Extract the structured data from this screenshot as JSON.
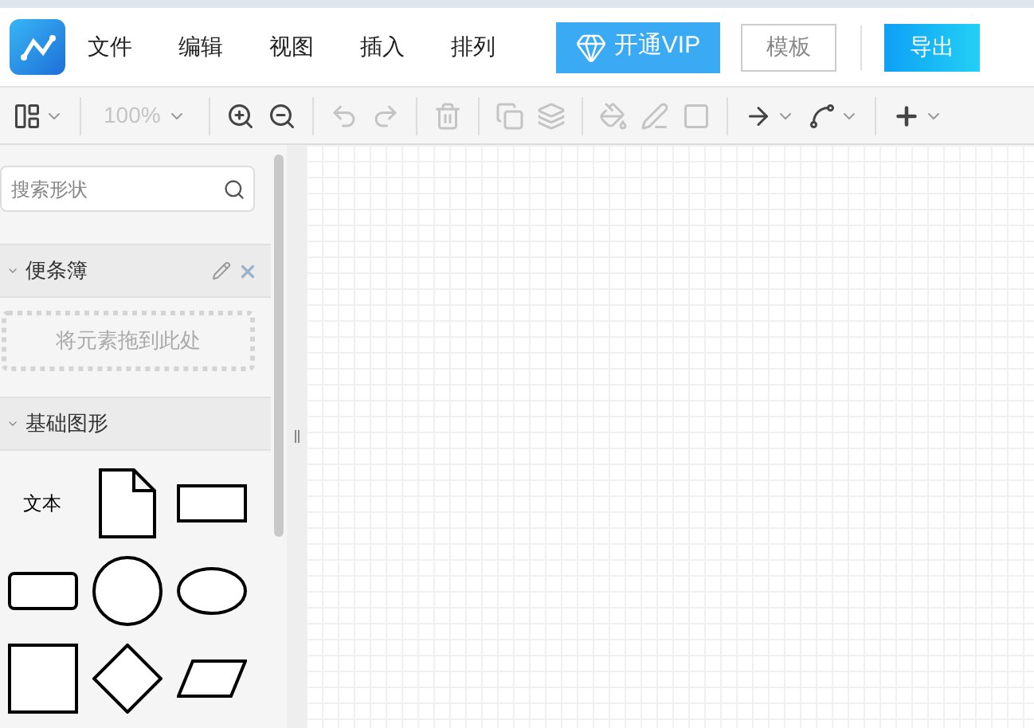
{
  "menu": [
    {
      "label": "文件"
    },
    {
      "label": "编辑"
    },
    {
      "label": "视图"
    },
    {
      "label": "插入"
    },
    {
      "label": "排列"
    }
  ],
  "vip_button": "开通VIP",
  "template_button": "模板",
  "export_button": "导出",
  "toolbar": [
    {
      "kind": "layout",
      "disabled": false,
      "dropdown": true
    },
    {
      "kind": "sep"
    },
    {
      "kind": "zoom",
      "label": "100%",
      "disabled": true,
      "dropdown": true
    },
    {
      "kind": "sep"
    },
    {
      "kind": "zoom-in",
      "disabled": false
    },
    {
      "kind": "zoom-out",
      "disabled": false
    },
    {
      "kind": "sep"
    },
    {
      "kind": "undo",
      "disabled": true
    },
    {
      "kind": "redo",
      "disabled": true
    },
    {
      "kind": "sep"
    },
    {
      "kind": "delete",
      "disabled": true
    },
    {
      "kind": "sep"
    },
    {
      "kind": "front",
      "disabled": true
    },
    {
      "kind": "back",
      "disabled": true
    },
    {
      "kind": "sep"
    },
    {
      "kind": "fill",
      "disabled": true
    },
    {
      "kind": "line",
      "disabled": true
    },
    {
      "kind": "shadow",
      "disabled": true
    },
    {
      "kind": "sep"
    },
    {
      "kind": "arrow",
      "disabled": false,
      "dropdown": true
    },
    {
      "kind": "connector",
      "disabled": false,
      "dropdown": true
    },
    {
      "kind": "sep"
    },
    {
      "kind": "plus",
      "disabled": false,
      "dropdown": true
    }
  ],
  "search": {
    "placeholder": "搜索形状"
  },
  "scratchpad": {
    "title": "便条簿",
    "expanded": true,
    "drop_hint": "将元素拖到此处"
  },
  "basic_shapes": {
    "title": "基础图形",
    "expanded": true,
    "shapes": [
      {
        "kind": "text",
        "label": "文本"
      },
      {
        "kind": "document"
      },
      {
        "kind": "rectangle"
      },
      {
        "kind": "rounded-rectangle"
      },
      {
        "kind": "circle"
      },
      {
        "kind": "ellipse"
      },
      {
        "kind": "square"
      },
      {
        "kind": "diamond"
      },
      {
        "kind": "parallelogram"
      }
    ]
  }
}
